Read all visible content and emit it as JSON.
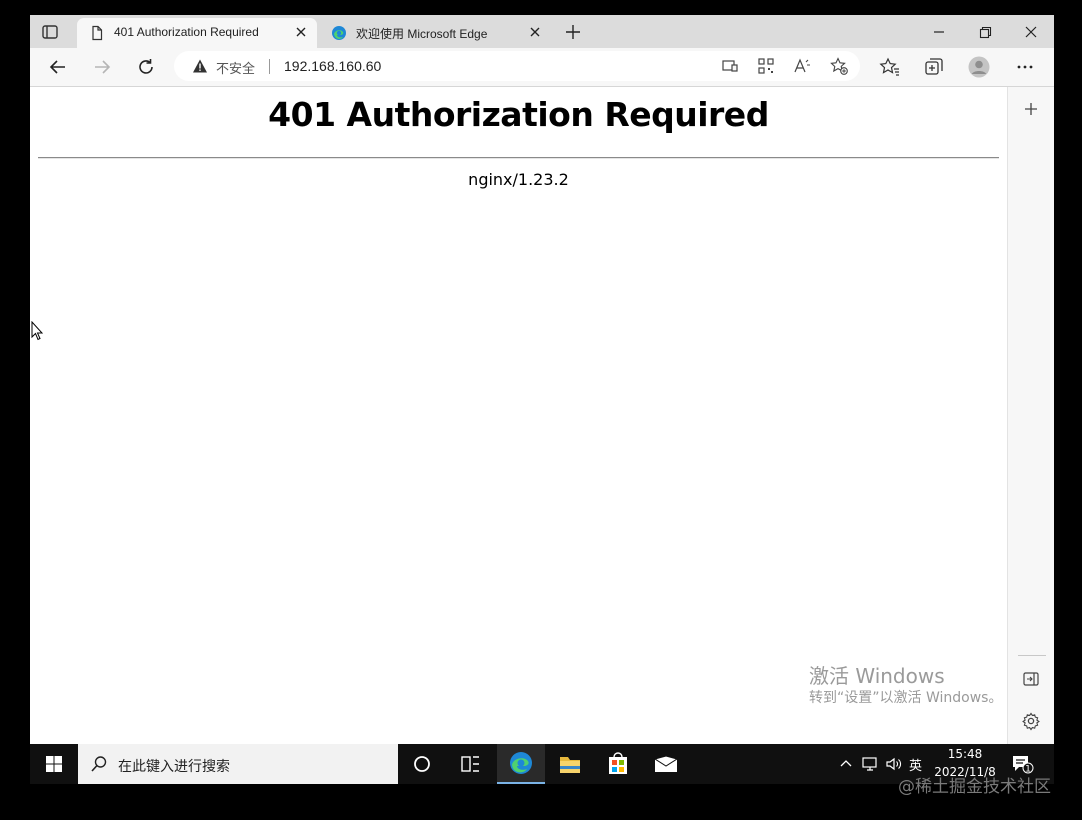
{
  "browser": {
    "tabs": [
      {
        "title": "401 Authorization Required",
        "active": true
      },
      {
        "title": "欢迎使用 Microsoft Edge",
        "active": false
      }
    ],
    "address": {
      "security_label": "不安全",
      "url": "192.168.160.60"
    }
  },
  "page": {
    "heading": "401 Authorization Required",
    "server": "nginx/1.23.2"
  },
  "activation": {
    "line1": "激活 Windows",
    "line2": "转到“设置”以激活 Windows。"
  },
  "taskbar": {
    "search_placeholder": "在此键入进行搜索",
    "language": "英",
    "time": "15:48",
    "date": "2022/11/8",
    "notification_count": "1"
  },
  "watermark": "@稀土掘金技术社区",
  "colors": {
    "accent": "#0f6cbd",
    "tab_strip": "#dcdcdc",
    "toolbar": "#f7f7f7",
    "taskbar": "#101010"
  }
}
